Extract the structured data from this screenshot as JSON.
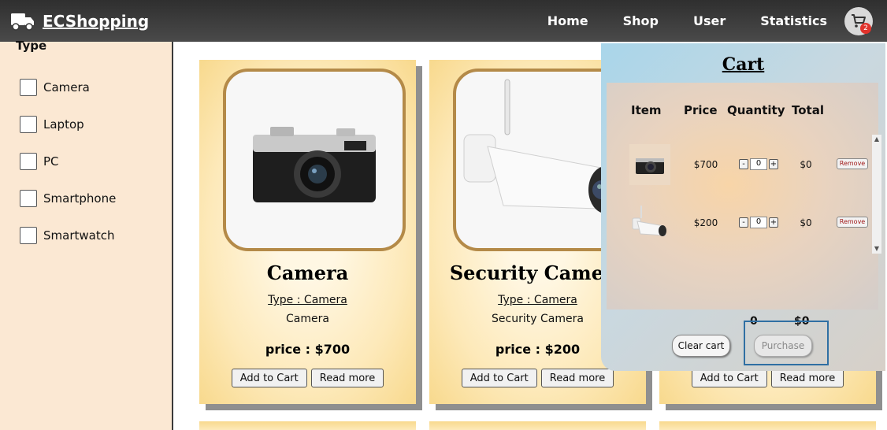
{
  "header": {
    "brand": "ECShopping",
    "nav": [
      "Home",
      "Shop",
      "User",
      "Statistics"
    ],
    "cart_count": "2"
  },
  "sidebar": {
    "title": "Type",
    "filters": [
      "Camera",
      "Laptop",
      "PC",
      "Smartphone",
      "Smartwatch"
    ]
  },
  "products": [
    {
      "name": "Camera",
      "type_label": "Type : Camera",
      "description": "Camera",
      "price": "price : $700",
      "add_label": "Add to Cart",
      "more_label": "Read more"
    },
    {
      "name": "Security Camera",
      "type_label": "Type : Camera",
      "description": "Security Camera",
      "price": "price : $200",
      "add_label": "Add to Cart",
      "more_label": "Read more"
    },
    {
      "name": "",
      "type_label": "",
      "description": "",
      "price": "",
      "add_label": "Add to Cart",
      "more_label": "Read more"
    }
  ],
  "cart": {
    "title": "Cart",
    "headers": {
      "item": "Item",
      "price": "Price",
      "quantity": "Quantity",
      "total": "Total"
    },
    "rows": [
      {
        "price": "$700",
        "qty": "0",
        "total": "$0",
        "remove": "Remove"
      },
      {
        "price": "$200",
        "qty": "0",
        "total": "$0",
        "remove": "Remove"
      }
    ],
    "sum_qty": "0",
    "sum_total": "$0",
    "clear_label": "Clear cart",
    "purchase_label": "Purchase",
    "minus": "-",
    "plus": "+"
  }
}
